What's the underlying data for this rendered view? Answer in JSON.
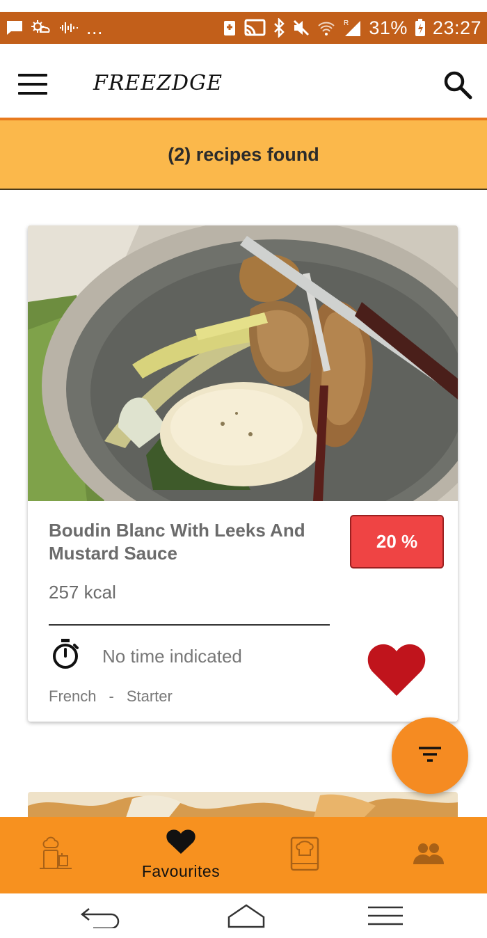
{
  "status_bar": {
    "ellipsis": "...",
    "battery_percent": "31%",
    "time": "23:27"
  },
  "app_bar": {
    "brand": "FREEZDGE",
    "menu_icon": "hamburger-menu-icon",
    "search_icon": "search-icon"
  },
  "banner": {
    "text": "(2) recipes found"
  },
  "recipes": [
    {
      "title": "Boudin Blanc With Leeks And Mustard Sauce",
      "match_percent": "20 %",
      "calories": "257 kcal",
      "time": "No time indicated",
      "cuisine": "French",
      "separator": "-",
      "course": "Starter",
      "favourite": true
    }
  ],
  "fab": {
    "icon": "filter-icon"
  },
  "bottom_nav": {
    "items": [
      {
        "icon": "fridge-chef-icon",
        "label": ""
      },
      {
        "icon": "heart-icon",
        "label": "Favourites"
      },
      {
        "icon": "recipe-book-icon",
        "label": ""
      },
      {
        "icon": "people-icon",
        "label": ""
      }
    ],
    "active_index": 1
  },
  "colors": {
    "status_bar": "#c25f1a",
    "accent_orange": "#f7911f",
    "banner": "#fbb84b",
    "badge_red": "#ef4444",
    "heart_red": "#c0141c"
  }
}
